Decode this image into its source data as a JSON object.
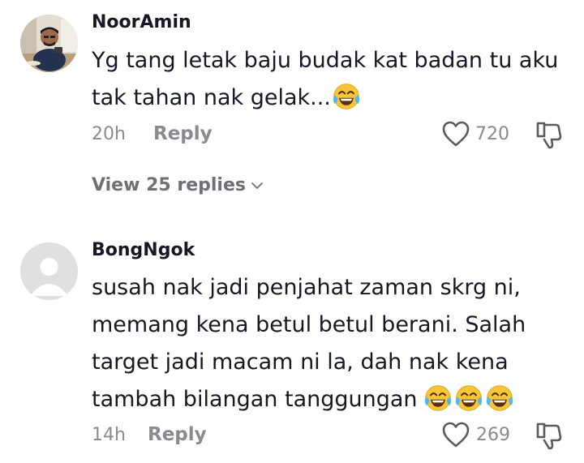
{
  "comments": [
    {
      "username": "NoorAmin",
      "text_line1": "Yg tang letak baju budak kat badan tu aku",
      "text_line2": "tak tahan nak gelak...",
      "time": "20h",
      "reply_label": "Reply",
      "likes": "720",
      "view_replies": "View 25 replies"
    },
    {
      "username": "BongNgok",
      "text_line1": "susah nak jadi penjahat zaman skrg ni,",
      "text_line2": "memang kena betul betul berani. Salah",
      "text_line3": "target jadi macam ni la, dah nak kena",
      "text_line4": "tambah bilangan tanggungan",
      "time": "14h",
      "reply_label": "Reply",
      "likes": "269"
    }
  ],
  "icons": {
    "like": "heart-outline-icon",
    "dislike": "thumbs-down-icon",
    "emoji": "face-with-tears-of-joy-emoji",
    "chevron": "chevron-down-icon"
  },
  "colors": {
    "text_primary": "#161823",
    "text_secondary": "#8a8b91",
    "emoji_yellow": "#f7b733"
  }
}
